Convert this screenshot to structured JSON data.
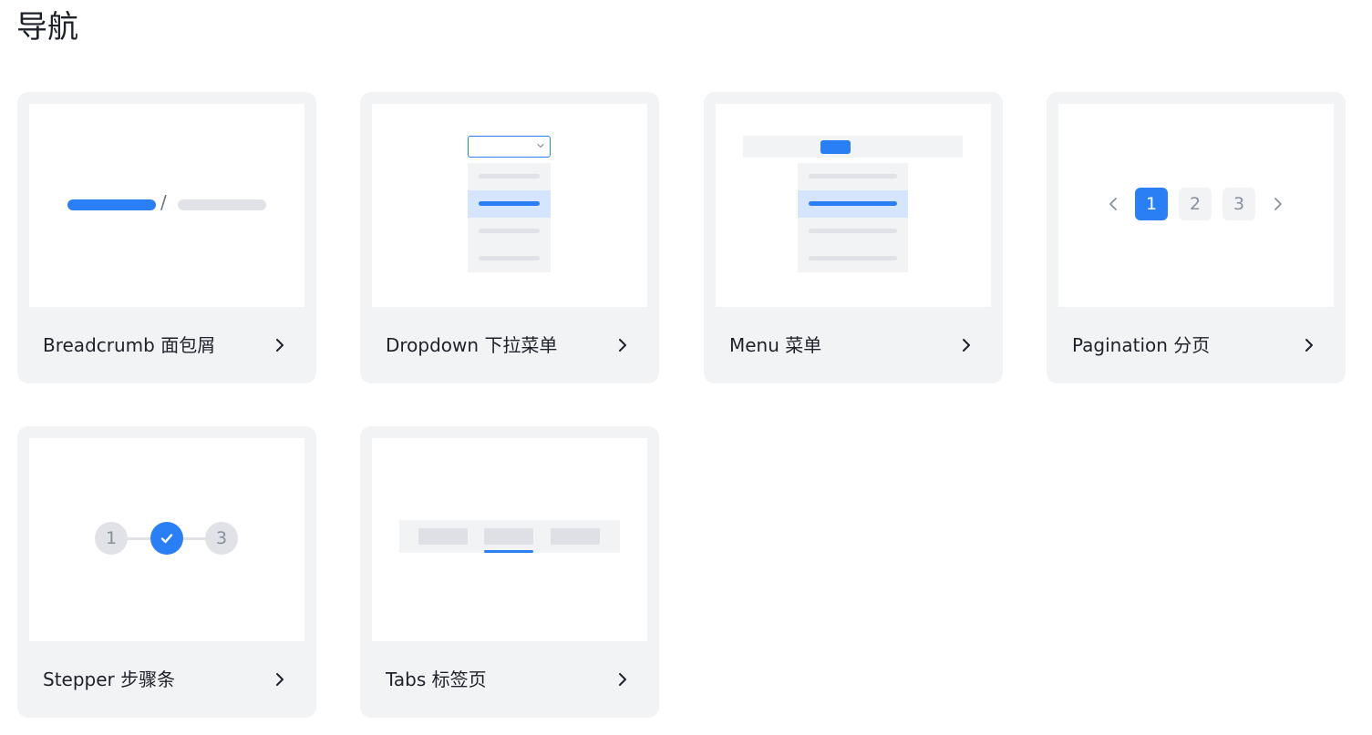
{
  "page": {
    "title": "导航"
  },
  "colors": {
    "accent": "#2b7ff5",
    "card_bg": "#f2f3f5",
    "placeholder": "#e0e2e8",
    "highlight": "#d4e5fd"
  },
  "cards": [
    {
      "id": "breadcrumb",
      "label": "Breadcrumb 面包屑",
      "arrow_icon": "chevron-right-icon"
    },
    {
      "id": "dropdown",
      "label": "Dropdown 下拉菜单",
      "arrow_icon": "chevron-right-icon"
    },
    {
      "id": "menu",
      "label": "Menu 菜单",
      "arrow_icon": "chevron-right-icon"
    },
    {
      "id": "pagination",
      "label": "Pagination 分页",
      "arrow_icon": "chevron-right-icon"
    },
    {
      "id": "stepper",
      "label": "Stepper 步骤条",
      "arrow_icon": "chevron-right-icon"
    },
    {
      "id": "tabs",
      "label": "Tabs 标签页",
      "arrow_icon": "chevron-right-icon"
    }
  ],
  "previews": {
    "breadcrumb": {
      "separator": "/"
    },
    "pagination": {
      "pages": [
        "1",
        "2",
        "3"
      ],
      "current": "1"
    },
    "stepper": {
      "steps": [
        "1",
        "2",
        "3"
      ],
      "completed_step": "2"
    }
  }
}
